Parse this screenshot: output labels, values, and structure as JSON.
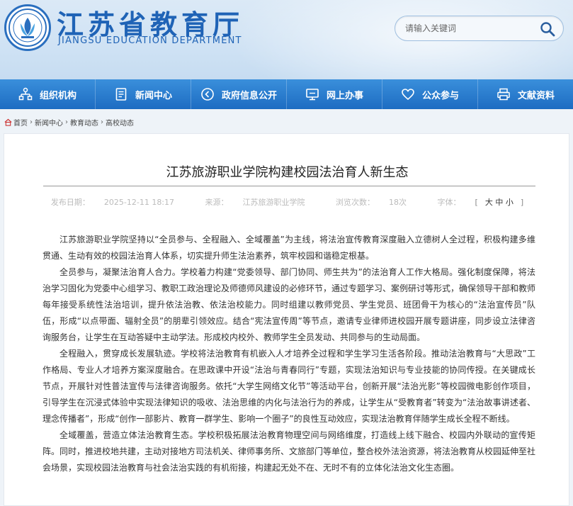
{
  "site": {
    "name_cn": "江苏省教育厅",
    "name_en": "JIANGSU EDUCATION DEPARTMENT"
  },
  "search": {
    "placeholder": "请输入关键词"
  },
  "nav": [
    {
      "label": "组织机构",
      "icon": "org-chart-icon"
    },
    {
      "label": "新闻中心",
      "icon": "document-icon"
    },
    {
      "label": "政府信息公开",
      "icon": "play-circle-icon"
    },
    {
      "label": "网上办事",
      "icon": "monitor-icon"
    },
    {
      "label": "公众参与",
      "icon": "heart-icon"
    },
    {
      "label": "文献资料",
      "icon": "printer-icon"
    }
  ],
  "breadcrumb": [
    "首页",
    "新闻中心",
    "教育动态",
    "高校动态"
  ],
  "article": {
    "title": "江苏旅游职业学院构建校园法治育人新生态",
    "publish_label": "发布日期：",
    "publish_date": "2025-12-11 18:17",
    "source_label": "来源：",
    "source": "江苏旅游职业学院",
    "views_label": "浏览次数：",
    "views": "18次",
    "font_label": "字体：",
    "font_large": "大",
    "font_medium": "中",
    "font_small": "小",
    "paragraphs": [
      "江苏旅游职业学院坚持以“全员参与、全程融入、全域覆盖”为主线，将法治宣传教育深度融入立德树人全过程，积极构建多维贯通、生动有效的校园法治育人体系，切实提升师生法治素养，筑牢校园和谐稳定根基。",
      "全员参与，凝聚法治育人合力。学校着力构建“党委领导、部门协同、师生共为”的法治育人工作大格局。强化制度保障，将法治学习固化为党委中心组学习、教职工政治理论及师德师风建设的必修环节，通过专题学习、案例研讨等形式，确保领导干部和教师每年接受系统性法治培训，提升依法治教、依法治校能力。同时组建以教师党员、学生党员、班团骨干为核心的“法治宣传员”队伍，形成“以点带面、辐射全员”的朋辈引领效应。结合“宪法宣传周”等节点，邀请专业律师进校园开展专题讲座，同步设立法律咨询服务台，让学生在互动答疑中主动学法。形成校内校外、教师学生全员发动、共同参与的生动局面。",
      "全程融入，贯穿成长发展轨迹。学校将法治教育有机嵌入人才培养全过程和学生学习生活各阶段。推动法治教育与“大思政”工作格局、专业人才培养方案深度融合。在思政课中开设“法治与青春同行”专题，实现法治知识与专业技能的协同传授。在关键成长节点，开展针对性普法宣传与法律咨询服务。依托“大学生网络文化节”等活动平台，创新开展“法治光影”等校园微电影创作项目，引导学生在沉浸式体验中实现法律知识的吸收、法治思维的内化与法治行为的养成，让学生从“受教育者”转变为“法治故事讲述者、理念传播者”，形成“创作一部影片、教育一群学生、影响一个圈子”的良性互动效应，实现法治教育伴随学生成长全程不断线。",
      "全域覆盖，营造立体法治教育生态。学校积极拓展法治教育物理空间与网络维度，打造线上线下融合、校园内外联动的宣传矩阵。同时，推进校地共建，主动对接地方司法机关、律师事务所、文旅部门等单位，整合校外法治资源，将法治教育从校园延伸至社会场景，实现校园法治教育与社会法治实践的有机衔接，构建起无处不在、无时不有的立体化法治文化生态圈。"
    ]
  }
}
